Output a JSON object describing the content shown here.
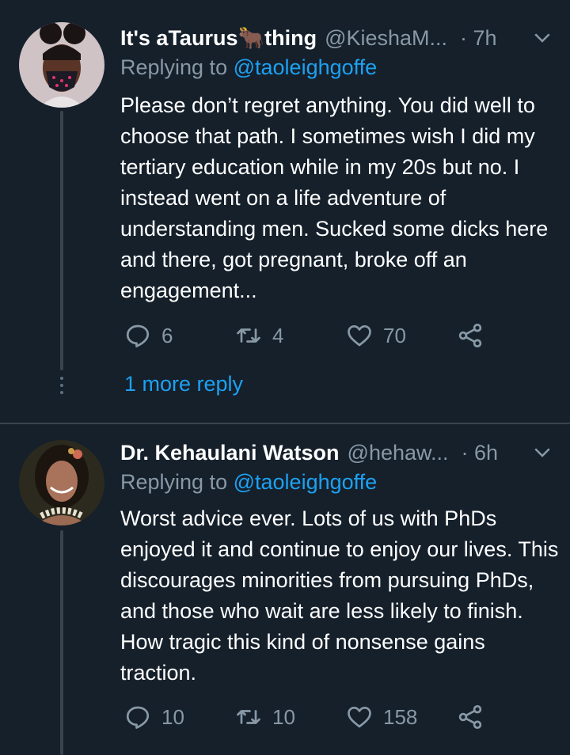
{
  "tweets": [
    {
      "name": "It's aTaurus",
      "name_emoji": "🐂",
      "name_suffix": "thing",
      "handle": "@KieshaM...",
      "time": "· 7h",
      "replying_prefix": "Replying to",
      "replying_to": "@taoleighgoffe",
      "text": "Please don’t regret anything. You did well to choose that path. I sometimes wish I did my tertiary education while in my 20s but no. I instead went on a life adventure of understanding men. Sucked some dicks here and there, got pregnant, broke off an engagement...",
      "replies": "6",
      "retweets": "4",
      "likes": "70",
      "more_replies": "1 more reply"
    },
    {
      "name": "Dr. Kehaulani Watson",
      "handle": "@hehaw...",
      "time": "· 6h",
      "replying_prefix": "Replying to",
      "replying_to": "@taoleighgoffe",
      "text": "Worst advice ever. Lots of us with PhDs enjoyed it and continue to enjoy our lives. This discourages minorities from pursuing PhDs, and those who wait are less likely to finish. How tragic this kind of nonsense gains traction.",
      "replies": "10",
      "retweets": "10",
      "likes": "158"
    }
  ],
  "colors": {
    "background": "#15202b",
    "secondary_text": "#8899a6",
    "link": "#1da1f2",
    "divider": "#38444d"
  },
  "icons": [
    "reply-icon",
    "retweet-icon",
    "like-icon",
    "share-icon",
    "chevron-down-icon"
  ]
}
